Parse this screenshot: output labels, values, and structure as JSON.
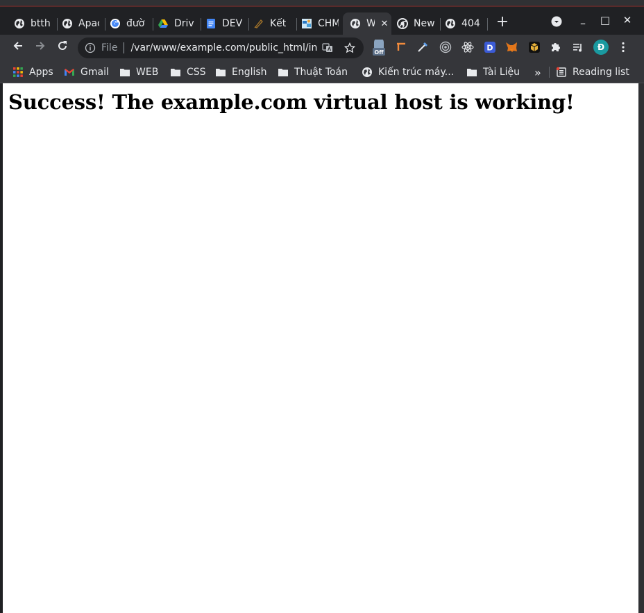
{
  "tabs": [
    {
      "title": "btth",
      "icon": "globe-icon"
    },
    {
      "title": "Apac",
      "icon": "globe-icon"
    },
    {
      "title": "đườ",
      "icon": "google-icon"
    },
    {
      "title": "Driv",
      "icon": "drive-icon"
    },
    {
      "title": "DEV",
      "icon": "docs-icon"
    },
    {
      "title": "Kết",
      "icon": "pin-icon"
    },
    {
      "title": "CHM",
      "icon": "chm-icon"
    },
    {
      "title": "W",
      "icon": "globe-icon",
      "active": true
    },
    {
      "title": "New",
      "icon": "chrome-icon"
    },
    {
      "title": "404",
      "icon": "globe-icon"
    }
  ],
  "window": {
    "new_tab": "+",
    "minimize": "–",
    "maximize": "□",
    "close": "✕"
  },
  "omnibox": {
    "label": "File",
    "url": "/var/www/example.com/public_html/in..."
  },
  "profile": {
    "initial": "Đ",
    "color": "#1a9aa0"
  },
  "extensions": [
    "off-extension-icon",
    "tool-icon",
    "pen-icon",
    "target-icon",
    "react-icon",
    "d-extension-icon",
    "metamask-icon",
    "cube-icon",
    "puzzle-icon",
    "media-icon"
  ],
  "bookmarks": [
    {
      "label": "Apps",
      "icon": "apps-grid-icon"
    },
    {
      "label": "Gmail",
      "icon": "gmail-icon"
    },
    {
      "label": "WEB",
      "icon": "folder-icon"
    },
    {
      "label": "CSS",
      "icon": "folder-icon"
    },
    {
      "label": "English",
      "icon": "folder-icon"
    },
    {
      "label": "Thuật Toán",
      "icon": "folder-icon"
    },
    {
      "label": "Kiến trúc máy...",
      "icon": "globe-icon"
    },
    {
      "label": "Tài Liệu",
      "icon": "folder-icon"
    }
  ],
  "bookmarks_more": "»",
  "reading_list": "Reading list",
  "page": {
    "heading": "Success!  The example.com virtual host is working!"
  },
  "colors": {
    "frame": "#202124",
    "toolbar": "#35363a",
    "text": "#e8eaed",
    "page_bg": "#ffffff"
  }
}
